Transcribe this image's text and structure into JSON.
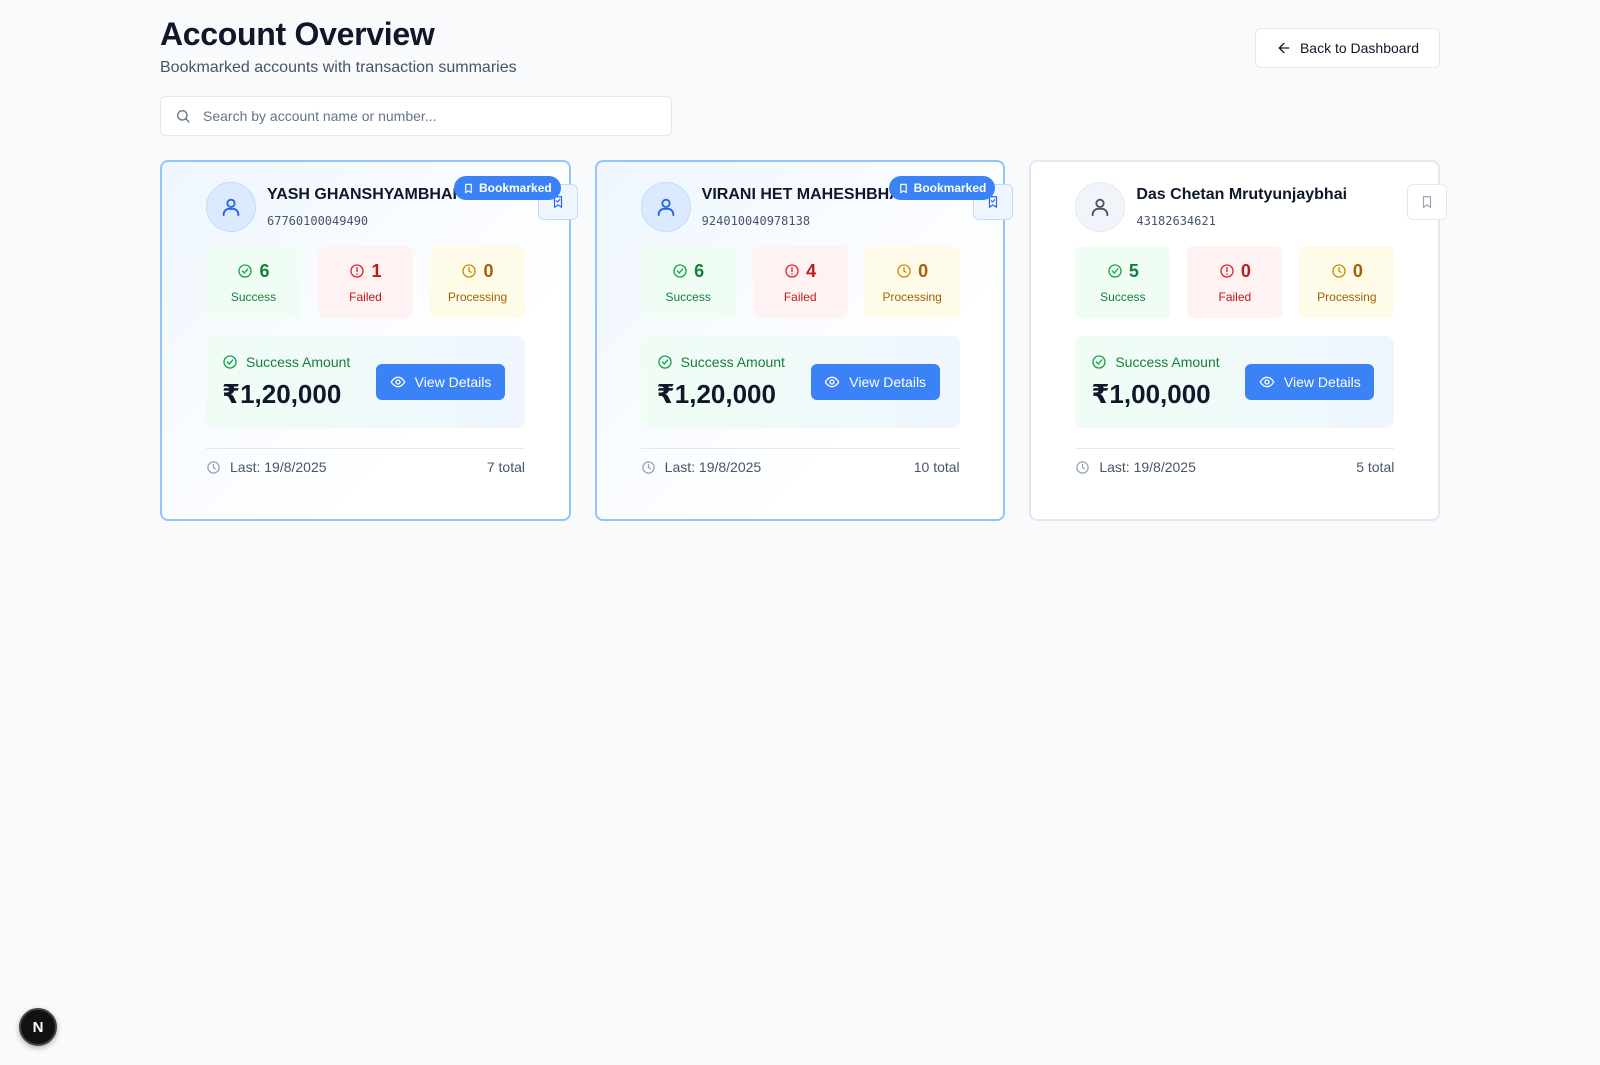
{
  "header": {
    "title": "Account Overview",
    "subtitle": "Bookmarked accounts with transaction summaries",
    "back_label": "Back to Dashboard"
  },
  "search": {
    "placeholder": "Search by account name or number..."
  },
  "accounts": [
    {
      "name": "YASH GHANSHYAMBHAI KORDIYA",
      "number": "67760100049490",
      "bookmarked": true,
      "badge": "Bookmarked",
      "stats": {
        "success": "6",
        "failed": "1",
        "processing": "0"
      },
      "success_amount": "₹1,20,000",
      "last": "Last: 19/8/2025",
      "total": "7 total"
    },
    {
      "name": "VIRANI HET MAHESHBHAI",
      "number": "924010040978138",
      "bookmarked": true,
      "badge": "Bookmarked",
      "stats": {
        "success": "6",
        "failed": "4",
        "processing": "0"
      },
      "success_amount": "₹1,20,000",
      "last": "Last: 19/8/2025",
      "total": "10 total"
    },
    {
      "name": "Das Chetan Mrutyunjaybhai",
      "number": "43182634621",
      "bookmarked": false,
      "stats": {
        "success": "5",
        "failed": "0",
        "processing": "0"
      },
      "success_amount": "₹1,00,000",
      "last": "Last: 19/8/2025",
      "total": "5 total"
    }
  ],
  "labels": {
    "success": "Success",
    "failed": "Failed",
    "processing": "Processing",
    "success_amount": "Success Amount",
    "view_details": "View Details"
  },
  "dev_badge": "N",
  "colors": {
    "accent": "#3b82f6",
    "success": "#15803d",
    "failed": "#b91c1c",
    "processing": "#a16207"
  },
  "icons": {
    "back": "arrow-left-icon",
    "search": "search-icon",
    "avatar": "user-icon",
    "bookmark": "bookmark-icon",
    "success": "check-circle-icon",
    "failed": "alert-circle-icon",
    "processing": "clock-icon",
    "view": "eye-icon",
    "last": "clock-icon"
  }
}
